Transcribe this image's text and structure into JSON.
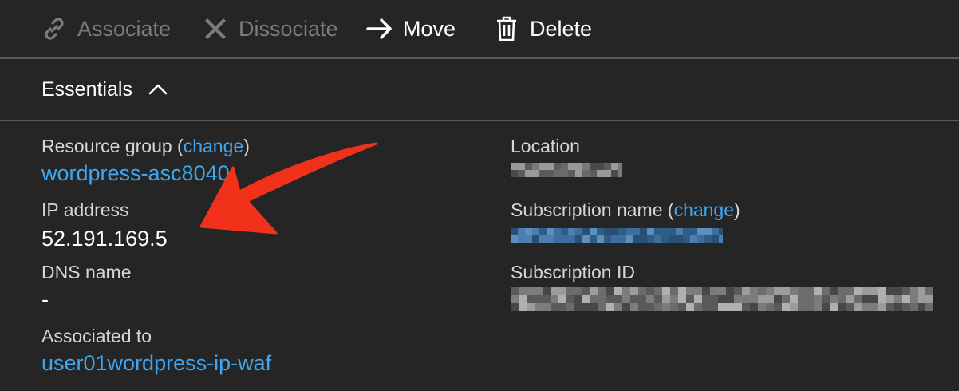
{
  "toolbar": {
    "associate_label": "Associate",
    "dissociate_label": "Dissociate",
    "move_label": "Move",
    "delete_label": "Delete"
  },
  "essentials": {
    "title": "Essentials"
  },
  "fields": {
    "resource_group": {
      "label": "Resource group",
      "paren_open": "(",
      "change": "change",
      "paren_close": ")",
      "value": "wordpress-asc8040"
    },
    "ip_address": {
      "label": "IP address",
      "value": "52.191.169.5"
    },
    "dns_name": {
      "label": "DNS name",
      "value": "-"
    },
    "associated_to": {
      "label": "Associated to",
      "value": "user01wordpress-ip-waf"
    },
    "location": {
      "label": "Location"
    },
    "subscription_name": {
      "label": "Subscription name",
      "paren_open": "(",
      "change": "change",
      "paren_close": ")"
    },
    "subscription_id": {
      "label": "Subscription ID"
    }
  },
  "colors": {
    "background": "#252526",
    "link": "#3ea7f2",
    "disabled": "#7c7c7c",
    "annotation_arrow": "#f2311b"
  }
}
